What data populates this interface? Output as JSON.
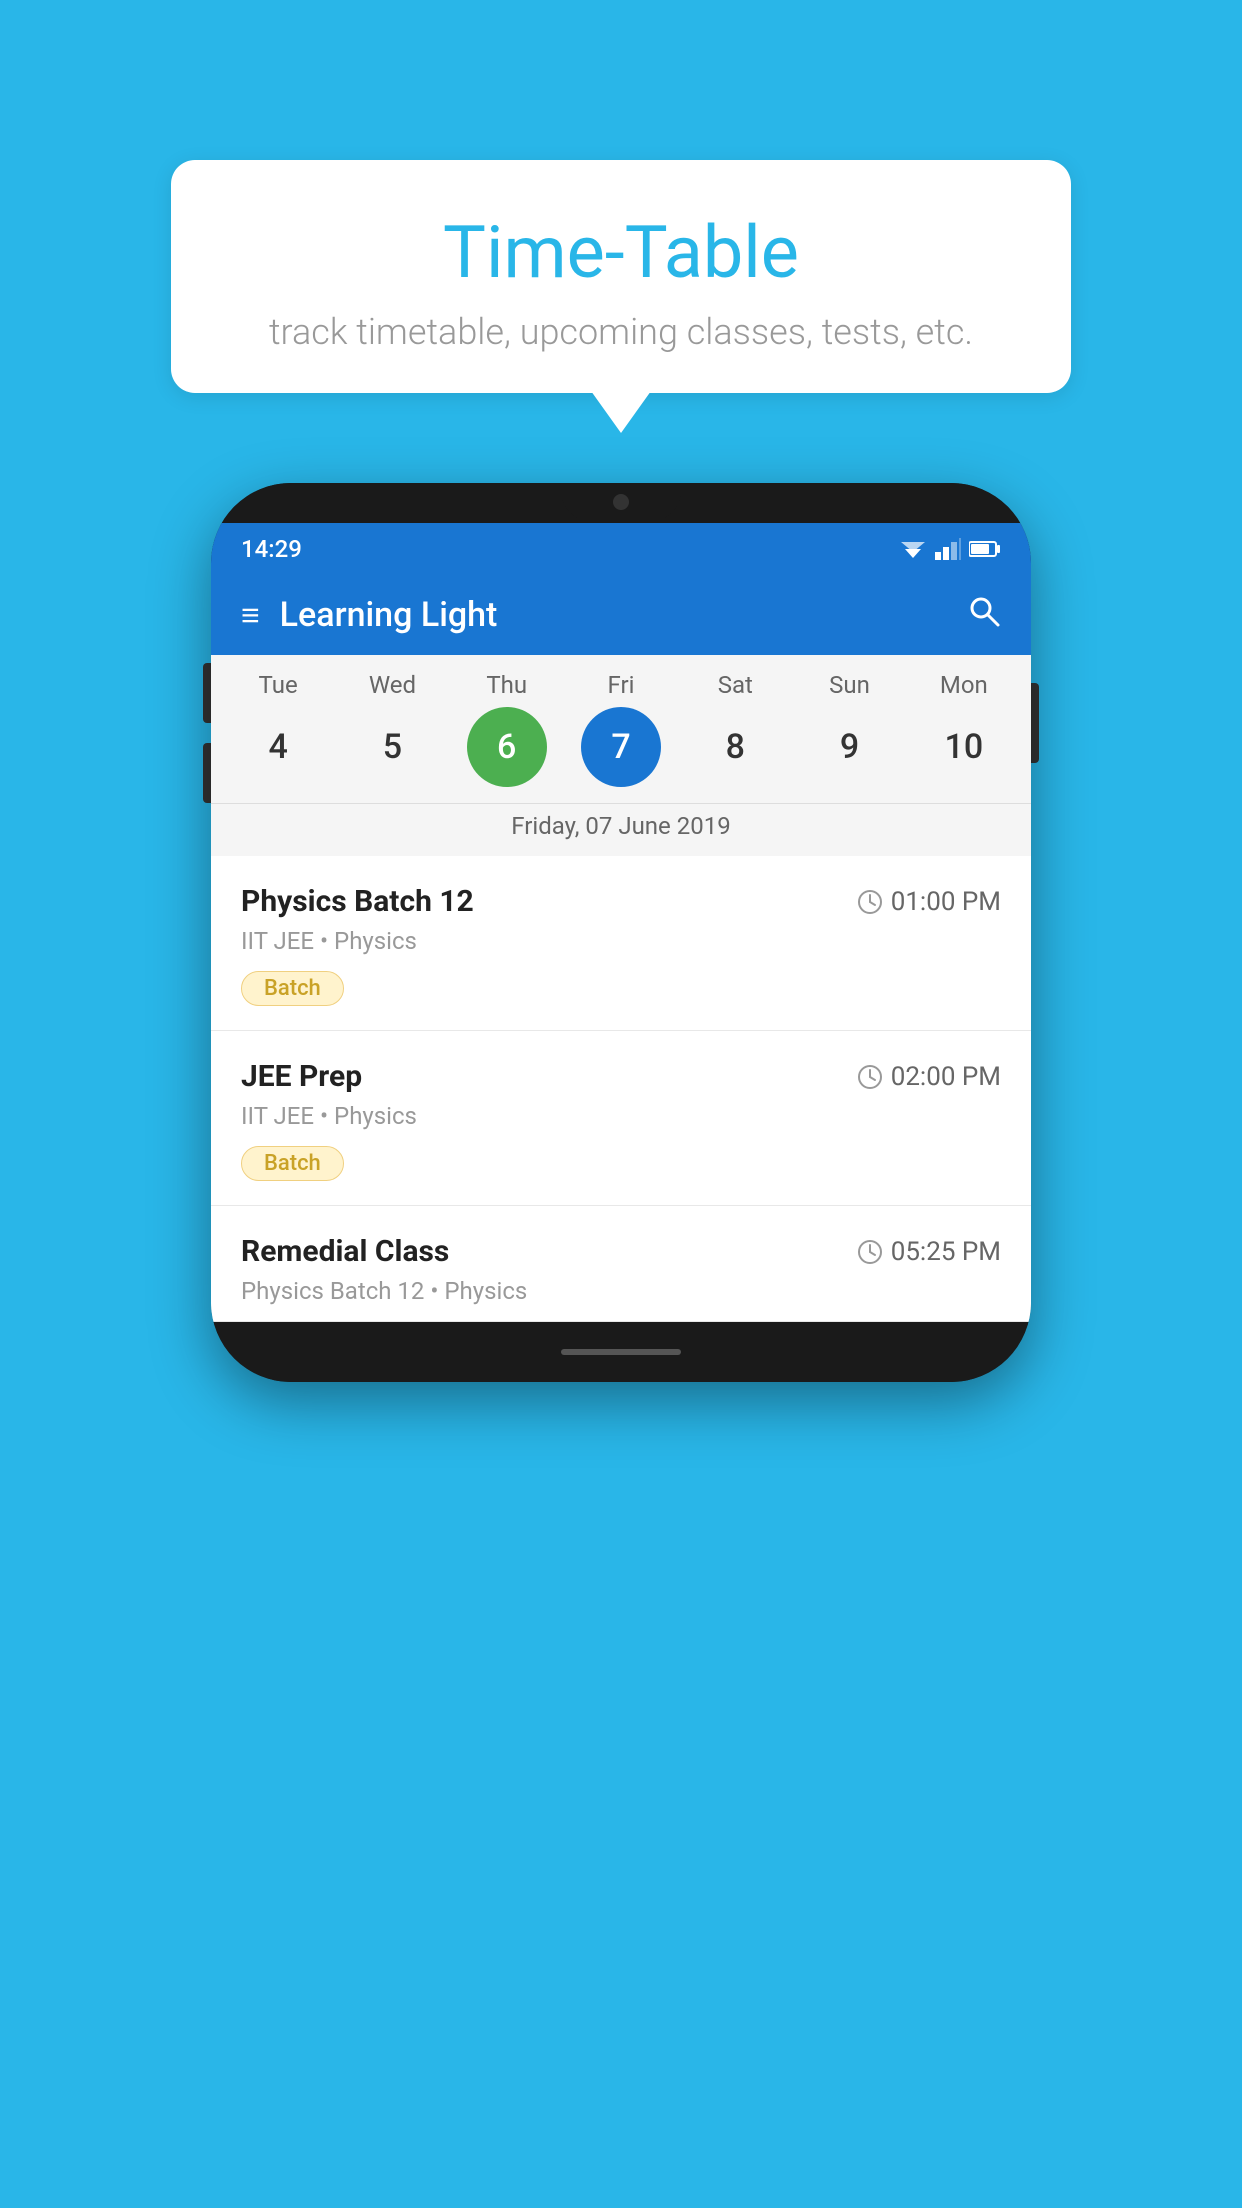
{
  "background_color": "#29b6e8",
  "tooltip": {
    "title": "Time-Table",
    "subtitle": "track timetable, upcoming classes, tests, etc."
  },
  "app": {
    "title": "Learning Light",
    "status_time": "14:29"
  },
  "calendar": {
    "days": [
      {
        "label": "Tue",
        "num": "4"
      },
      {
        "label": "Wed",
        "num": "5"
      },
      {
        "label": "Thu",
        "num": "6",
        "state": "today"
      },
      {
        "label": "Fri",
        "num": "7",
        "state": "selected"
      },
      {
        "label": "Sat",
        "num": "8"
      },
      {
        "label": "Sun",
        "num": "9"
      },
      {
        "label": "Mon",
        "num": "10"
      }
    ],
    "selected_date_label": "Friday, 07 June 2019"
  },
  "schedule": {
    "items": [
      {
        "name": "Physics Batch 12",
        "time": "01:00 PM",
        "sub": "IIT JEE • Physics",
        "badge": "Batch"
      },
      {
        "name": "JEE Prep",
        "time": "02:00 PM",
        "sub": "IIT JEE • Physics",
        "badge": "Batch"
      },
      {
        "name": "Remedial Class",
        "time": "05:25 PM",
        "sub": "Physics Batch 12 • Physics",
        "badge": null
      }
    ]
  },
  "labels": {
    "hamburger": "≡",
    "search": "🔍",
    "clock": "🕐"
  }
}
